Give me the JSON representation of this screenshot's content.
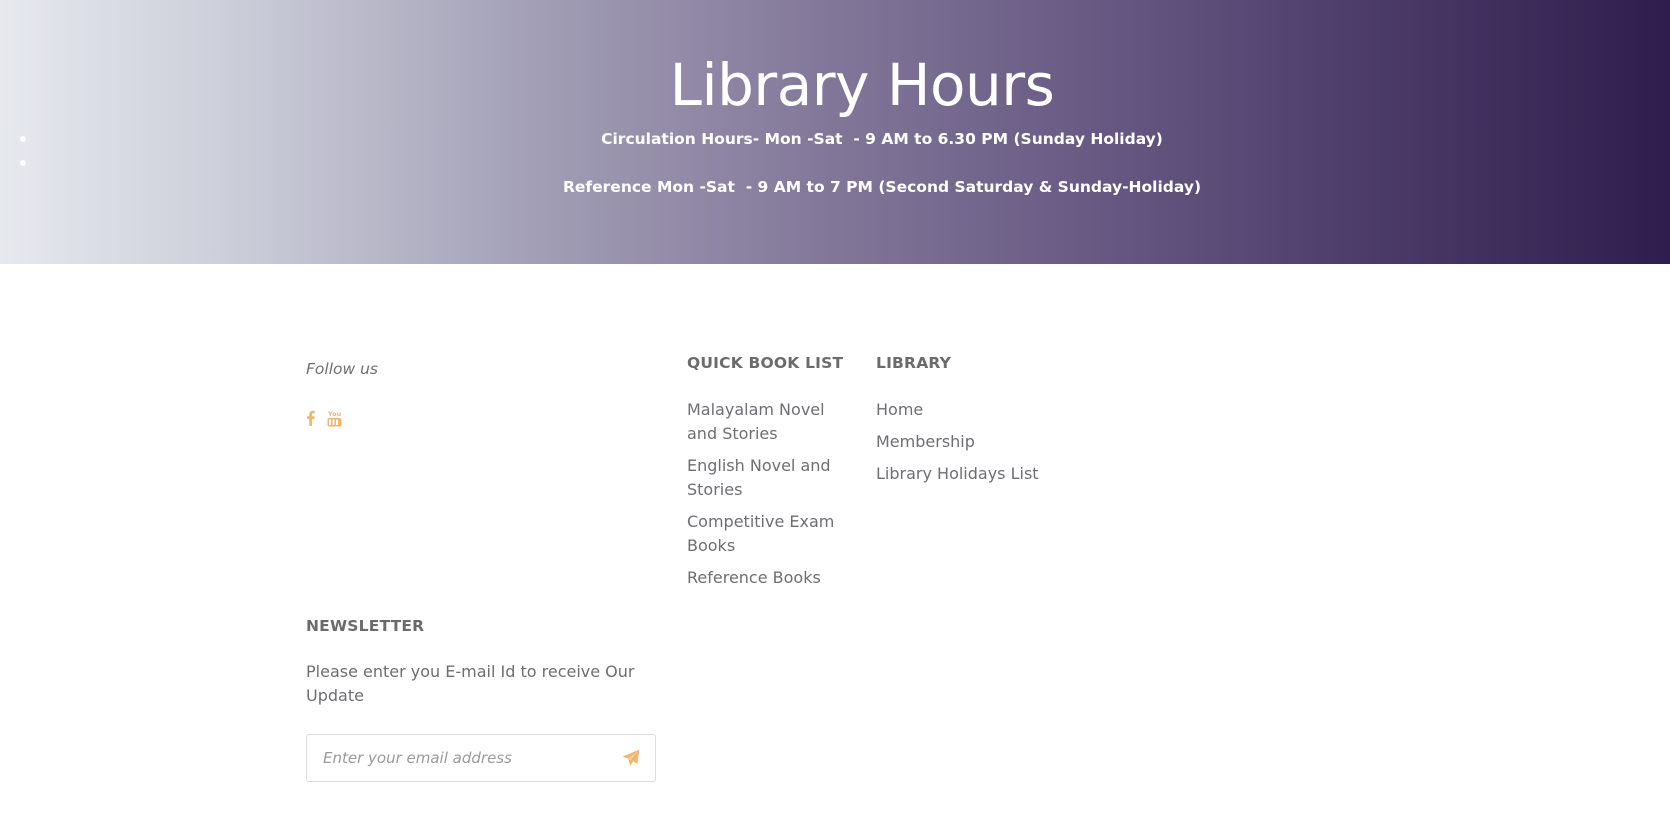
{
  "hero": {
    "title": "Library Hours",
    "circulation_line": "Circulation Hours- Mon -Sat  - 9 AM to 6.30 PM (Sunday Holiday)",
    "reference_line": "Reference Mon -Sat  - 9 AM to 7 PM (Second Saturday & Sunday-Holiday)",
    "gradient_colors": [
      "#e6e9ee",
      "#a29fb6",
      "#6a5c85",
      "#2f1e4d"
    ]
  },
  "follow": {
    "title": "Follow us",
    "icons": [
      "facebook-icon",
      "youtube-icon"
    ]
  },
  "quick_book_list": {
    "heading": "QUICK BOOK LIST",
    "items": [
      "Malayalam Novel and Stories",
      "English Novel and Stories",
      "Competitive Exam Books",
      "Reference Books"
    ]
  },
  "library": {
    "heading": "LIBRARY",
    "items": [
      "Home",
      "Membership",
      "Library Holidays List"
    ]
  },
  "newsletter": {
    "heading": "NEWSLETTER",
    "text": "Please enter you E-mail Id to receive Our Update",
    "placeholder": "Enter your email address",
    "value": "",
    "submit_icon": "paper-plane-icon"
  },
  "colors": {
    "accent": "#f3b56b",
    "text": "#6e6e73",
    "heading": "#6b6b6b"
  }
}
